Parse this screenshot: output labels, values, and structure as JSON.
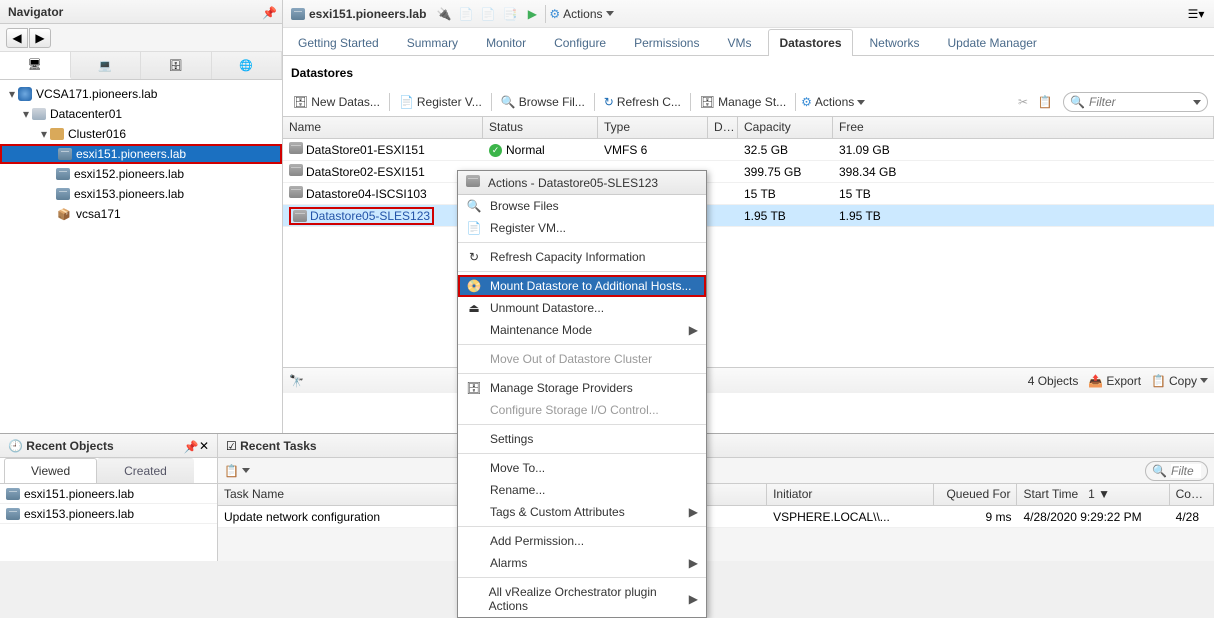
{
  "navigator": {
    "title": "Navigator",
    "tree": {
      "vc": "VCSA171.pioneers.lab",
      "datacenter": "Datacenter01",
      "cluster": "Cluster016",
      "hosts": [
        "esxi151.pioneers.lab",
        "esxi152.pioneers.lab",
        "esxi153.pioneers.lab",
        "vcsa171"
      ]
    }
  },
  "main": {
    "title": "esxi151.pioneers.lab",
    "actions_label": "Actions",
    "tabs": [
      "Getting Started",
      "Summary",
      "Monitor",
      "Configure",
      "Permissions",
      "VMs",
      "Datastores",
      "Networks",
      "Update Manager"
    ],
    "active_tab": "Datastores",
    "section": "Datastores",
    "actionbar": {
      "new_ds": "New Datas...",
      "register_vm": "Register V...",
      "browse": "Browse Fil...",
      "refresh": "Refresh C...",
      "manage": "Manage St...",
      "actions": "Actions",
      "filter_placeholder": "Filter"
    },
    "grid": {
      "columns": [
        "Name",
        "Status",
        "Type",
        "Da...",
        "Capacity",
        "Free"
      ],
      "rows": [
        {
          "name": "DataStore01-ESXI151",
          "status": "Normal",
          "type": "VMFS 6",
          "dv": "",
          "capacity": "32.5 GB",
          "free": "31.09 GB"
        },
        {
          "name": "DataStore02-ESXI151",
          "status": "",
          "type": "",
          "dv": "",
          "capacity": "399.75 GB",
          "free": "398.34 GB"
        },
        {
          "name": "Datastore04-ISCSI103",
          "status": "",
          "type": "",
          "dv": "",
          "capacity": "15 TB",
          "free": "15 TB"
        },
        {
          "name": "Datastore05-SLES123",
          "status": "",
          "type": "",
          "dv": "",
          "capacity": "1.95 TB",
          "free": "1.95 TB",
          "selected": true,
          "link": true,
          "highlight": true
        }
      ],
      "footer_objects": "4 Objects",
      "export": "Export",
      "copy": "Copy"
    }
  },
  "context_menu": {
    "title": "Actions - Datastore05-SLES123",
    "items": [
      {
        "label": "Browse Files",
        "icon": "🔍"
      },
      {
        "label": "Register VM...",
        "icon": "📄"
      },
      {
        "sep": true
      },
      {
        "label": "Refresh Capacity Information",
        "icon": "↻"
      },
      {
        "sep": true
      },
      {
        "label": "Mount Datastore to Additional Hosts...",
        "icon": "📀",
        "selected": true,
        "highlight": true
      },
      {
        "label": "Unmount Datastore...",
        "icon": "⏏"
      },
      {
        "label": "Maintenance Mode",
        "submenu": true
      },
      {
        "sep": true
      },
      {
        "label": "Move Out of Datastore Cluster",
        "disabled": true
      },
      {
        "sep": true
      },
      {
        "label": "Manage Storage Providers",
        "icon": "🗄"
      },
      {
        "label": "Configure Storage I/O Control...",
        "disabled": true
      },
      {
        "sep": true
      },
      {
        "label": "Settings"
      },
      {
        "sep": true
      },
      {
        "label": "Move To..."
      },
      {
        "label": "Rename..."
      },
      {
        "label": "Tags & Custom Attributes",
        "submenu": true
      },
      {
        "sep": true
      },
      {
        "label": "Add Permission..."
      },
      {
        "label": "Alarms",
        "submenu": true
      },
      {
        "sep": true
      },
      {
        "label": "All vRealize Orchestrator plugin Actions",
        "submenu": true
      }
    ]
  },
  "recent_objects": {
    "title": "Recent Objects",
    "tabs": [
      "Viewed",
      "Created"
    ],
    "items": [
      "esxi151.pioneers.lab",
      "esxi153.pioneers.lab"
    ]
  },
  "recent_tasks": {
    "title": "Recent Tasks",
    "filter_placeholder": "Filte",
    "columns": [
      "Task Name",
      "Initiator",
      "Queued For",
      "Start Time",
      "Comp"
    ],
    "sort_col": "Start Time",
    "rows": [
      {
        "task": "Update network configuration",
        "initiator": "VSPHERE.LOCAL\\\\...",
        "queued": "9 ms",
        "start": "4/28/2020 9:29:22 PM",
        "comp": "4/28"
      }
    ]
  }
}
